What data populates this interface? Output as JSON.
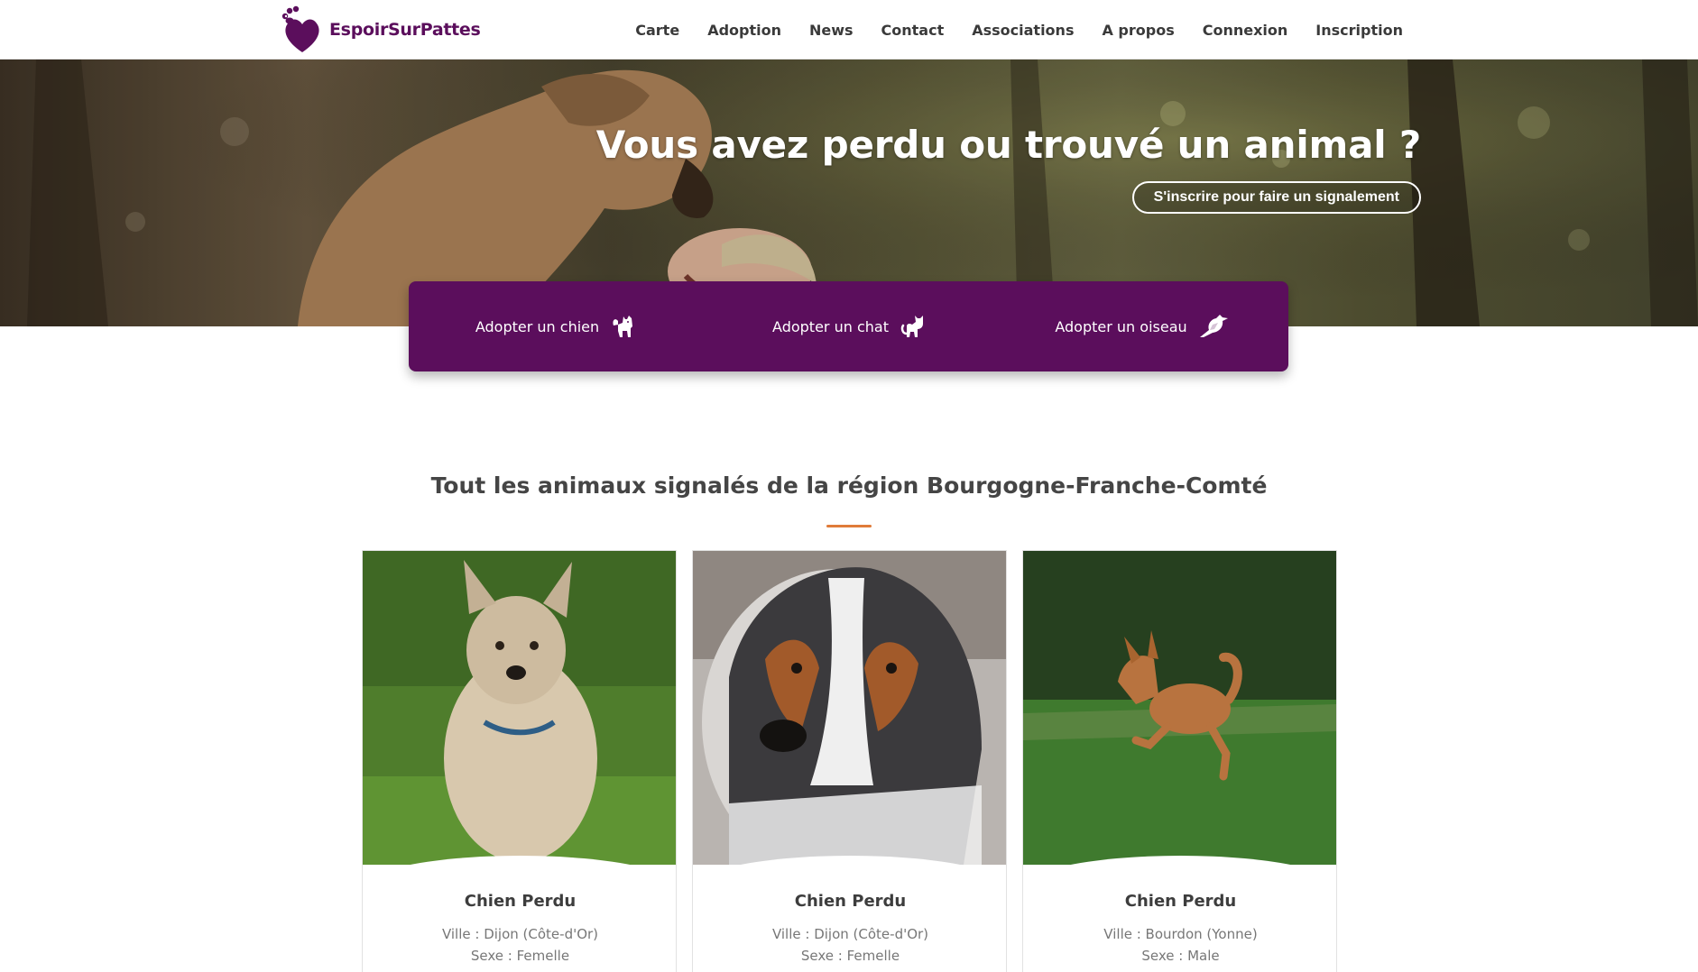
{
  "brand": {
    "name": "EspoirSurPattes",
    "color": "#5b0e5c"
  },
  "nav": {
    "items": [
      "Carte",
      "Adoption",
      "News",
      "Contact",
      "Associations",
      "A propos",
      "Connexion",
      "Inscription"
    ]
  },
  "hero": {
    "title": "Vous avez perdu ou trouvé un animal ?",
    "cta": "S'inscrire pour faire un signalement"
  },
  "adopt": {
    "items": [
      {
        "label": "Adopter un chien",
        "icon": "dog-icon"
      },
      {
        "label": "Adopter un chat",
        "icon": "cat-icon"
      },
      {
        "label": "Adopter un oiseau",
        "icon": "bird-icon"
      }
    ]
  },
  "section": {
    "title": "Tout les animaux signalés de la région Bourgogne-Franche-Comté",
    "accent": "#e07b39"
  },
  "cards": [
    {
      "title": "Chien Perdu",
      "ville": "Ville : Dijon (Côte-d'Or)",
      "sexe": "Sexe : Femelle"
    },
    {
      "title": "Chien Perdu",
      "ville": "Ville : Dijon (Côte-d'Or)",
      "sexe": "Sexe : Femelle"
    },
    {
      "title": "Chien Perdu",
      "ville": "Ville : Bourdon (Yonne)",
      "sexe": "Sexe : Male"
    }
  ]
}
